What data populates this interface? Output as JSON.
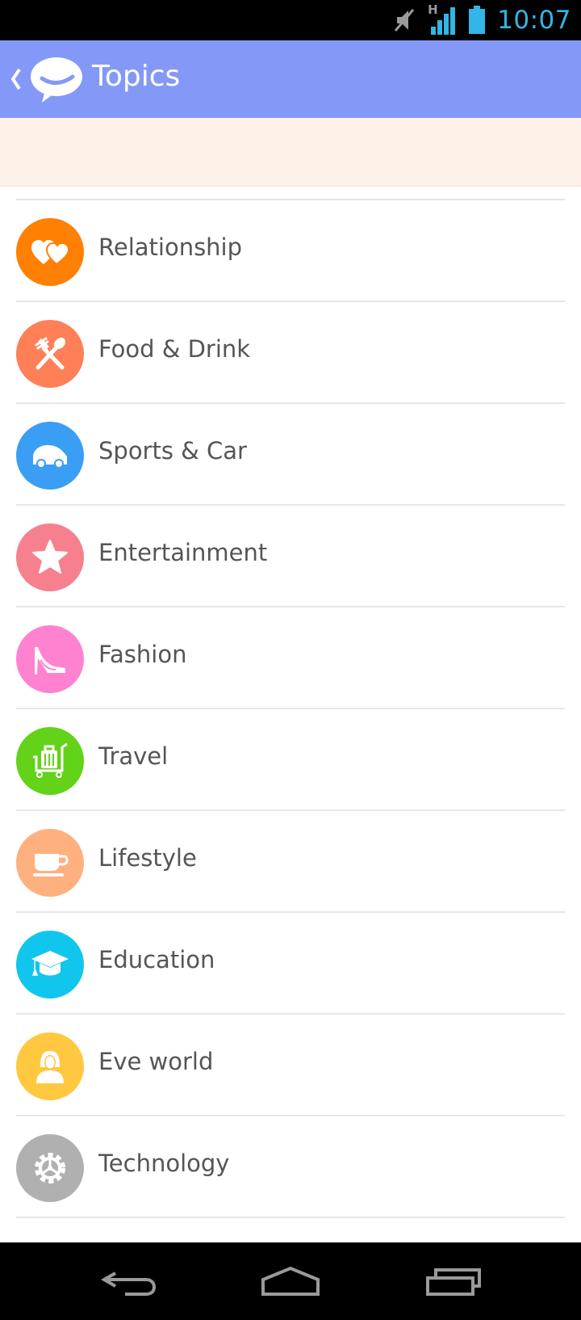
{
  "status_bar": {
    "time": "10:07",
    "network_type": "H",
    "icons": [
      "mute-icon",
      "signal-icon",
      "battery-icon"
    ]
  },
  "app_bar": {
    "title": "Topics",
    "color": "#8499f7"
  },
  "banner": {
    "color": "#fdf1e8"
  },
  "topics": [
    {
      "label": "Relationship",
      "icon": "hearts-icon",
      "color": "#ff8002"
    },
    {
      "label": "Food & Drink",
      "icon": "fork-spoon-icon",
      "color": "#ff7f57"
    },
    {
      "label": "Sports & Car",
      "icon": "car-icon",
      "color": "#3a9ef5"
    },
    {
      "label": "Entertainment",
      "icon": "star-icon",
      "color": "#f7808f"
    },
    {
      "label": "Fashion",
      "icon": "high-heel-icon",
      "color": "#ff82d0"
    },
    {
      "label": "Travel",
      "icon": "luggage-cart-icon",
      "color": "#62d318"
    },
    {
      "label": "Lifestyle",
      "icon": "coffee-cup-icon",
      "color": "#ffb07f"
    },
    {
      "label": "Education",
      "icon": "graduation-cap-icon",
      "color": "#11c6ec"
    },
    {
      "label": "Eve world",
      "icon": "woman-icon",
      "color": "#ffc840"
    },
    {
      "label": "Technology",
      "icon": "gear-icon",
      "color": "#b0b0b0"
    }
  ],
  "nav_bar": {
    "buttons": [
      "back-icon",
      "home-icon",
      "recent-apps-icon"
    ]
  }
}
